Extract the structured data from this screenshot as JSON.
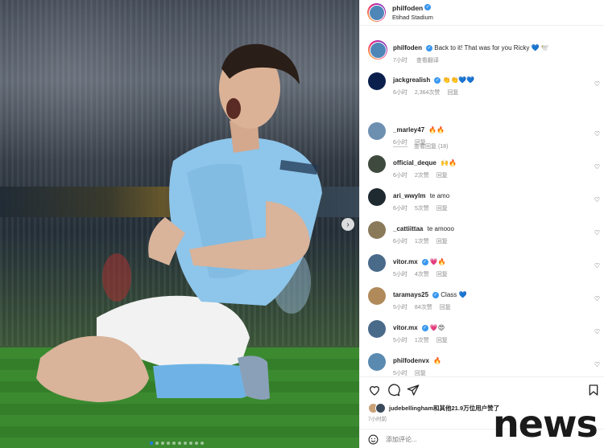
{
  "post": {
    "username": "philfoden",
    "location": "Etihad Stadium",
    "caption_user": "philfoden",
    "caption_text": "Back to it! That was for you Ricky 💙 🕊️",
    "caption_time": "7小时",
    "caption_translate": "查看翻译",
    "replies_label": "查看回复 (18)"
  },
  "comments": [
    {
      "user": "jackgrealish",
      "verified": true,
      "text": "👏👏💙💙",
      "time": "6小时",
      "likes": "2,364次赞",
      "reply": "回复",
      "avatar_color": "#0b1f4d"
    },
    {
      "user": "_marley47",
      "verified": false,
      "text": "🔥🔥",
      "time": "6小时",
      "likes": "",
      "reply": "回复",
      "avatar_color": "#6d8fb0"
    },
    {
      "user": "official_deque",
      "verified": false,
      "text": "🙌🔥",
      "time": "6小时",
      "likes": "2次赞",
      "reply": "回复",
      "avatar_color": "#3e4a3e"
    },
    {
      "user": "ari_wwylm",
      "verified": false,
      "text": "te amo",
      "time": "6小时",
      "likes": "5次赞",
      "reply": "回复",
      "avatar_color": "#1f2a30"
    },
    {
      "user": "_cattiittaa",
      "verified": false,
      "text": "te amooo",
      "time": "6小时",
      "likes": "1次赞",
      "reply": "回复",
      "avatar_color": "#8a7a5a"
    },
    {
      "user": "vitor.mx",
      "verified": true,
      "text": "💗🔥",
      "time": "5小时",
      "likes": "4次赞",
      "reply": "回复",
      "avatar_color": "#4a6a8a"
    },
    {
      "user": "taramays25",
      "verified": true,
      "text": "Class 💙",
      "time": "5小时",
      "likes": "84次赞",
      "reply": "回复",
      "avatar_color": "#b08a5a"
    },
    {
      "user": "vitor.mx",
      "verified": true,
      "text": "💗😍",
      "time": "5小时",
      "likes": "1次赞",
      "reply": "回复",
      "avatar_color": "#4a6a8a"
    },
    {
      "user": "philfodenvx",
      "verified": false,
      "text": "🔥",
      "time": "5小时",
      "likes": "",
      "reply": "回复",
      "avatar_color": "#5a8ab0"
    }
  ],
  "actions": {
    "like_icon": "heart-outline-icon",
    "comment_icon": "comment-icon",
    "share_icon": "paper-plane-icon",
    "save_icon": "bookmark-icon"
  },
  "likes_summary": {
    "user": "judebellingham",
    "rest": "和其他21.9万位用户赞了",
    "time": "7小时前"
  },
  "add_comment": {
    "placeholder": "添加评论...",
    "emoji_icon": "smiley-icon"
  },
  "watermark": "news",
  "colors": {
    "verified": "#3897f0",
    "muted": "#8e8e8e",
    "carousel_active": "#1c7cf0"
  }
}
